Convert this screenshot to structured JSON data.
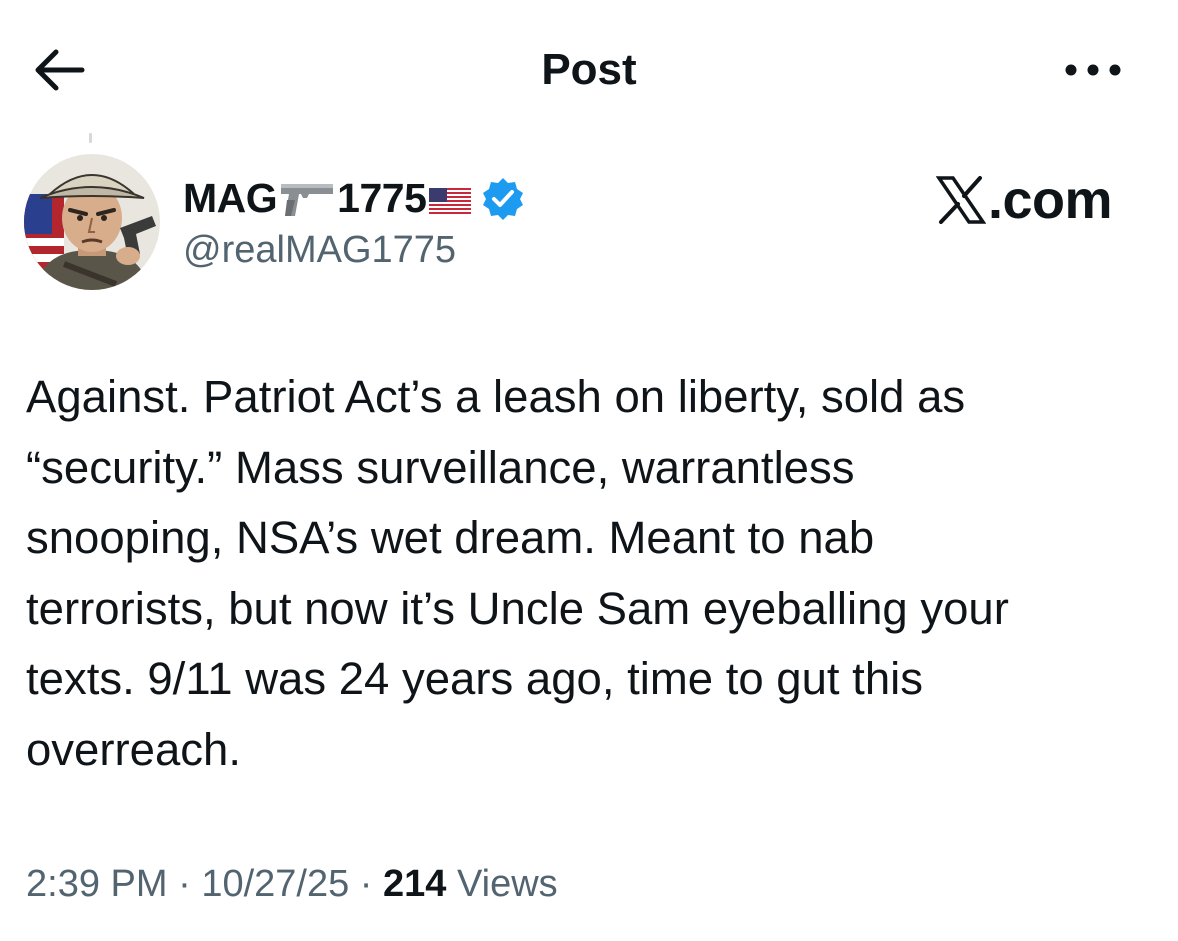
{
  "header": {
    "title": "Post",
    "back_icon": "arrow-left-icon",
    "more_icon": "more-horizontal-icon"
  },
  "author": {
    "display_name_prefix": "MAG",
    "display_name_suffix": "1775",
    "emoji": [
      "pistol-icon",
      "us-flag-icon"
    ],
    "verified": true,
    "verified_color": "#1d9bf0",
    "handle": "@realMAG1775"
  },
  "watermark": {
    "text": ".com",
    "logo_icon": "x-logo-icon"
  },
  "tweet": {
    "text": "Against. Patriot Act’s a leash on liberty, sold as\n“security.” Mass surveillance, warrantless\nsnooping, NSA’s wet dream. Meant to nab\nterrorists, but now it’s Uncle Sam eyeballing your\ntexts. 9/11 was 24 years ago, time to gut this\noverreach."
  },
  "meta": {
    "time": "2:39 PM",
    "separator": " · ",
    "date": "10/27/25",
    "views_count": "214",
    "views_label": " Views"
  },
  "colors": {
    "text_primary": "#0f1419",
    "text_secondary": "#536471",
    "accent": "#1d9bf0",
    "background": "#ffffff"
  }
}
